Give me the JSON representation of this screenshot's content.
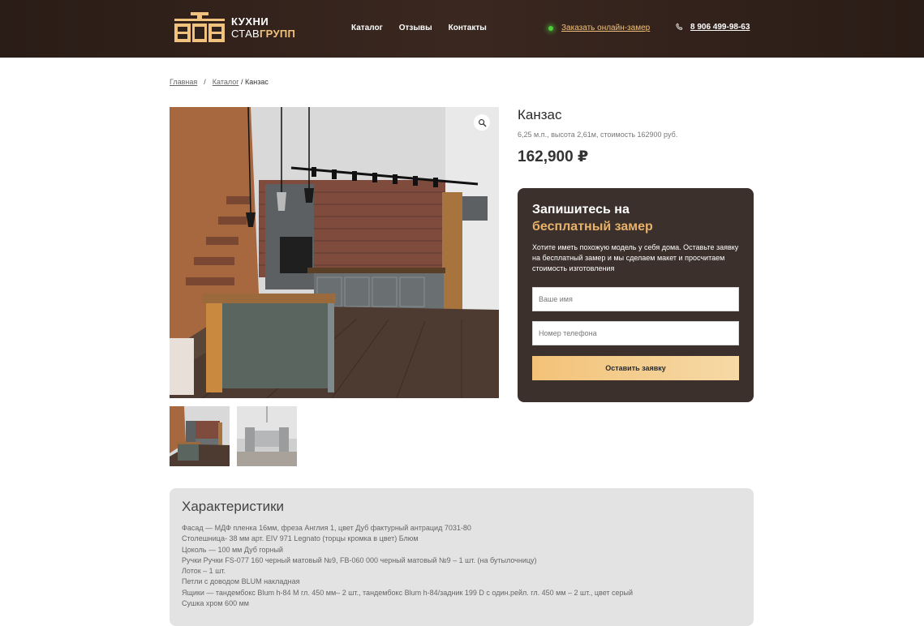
{
  "header": {
    "logo_line1": "КУХНИ",
    "logo_line2_a": "СТАВ",
    "logo_line2_b": "ГРУПП",
    "nav": [
      "Каталог",
      "Отзывы",
      "Контакты"
    ],
    "measure_link": "Заказать онлайн-замер",
    "phone": "8 906 499-98-63"
  },
  "breadcrumb": {
    "home": "Главная",
    "catalog": "Каталог",
    "current": "/ Канзас"
  },
  "product": {
    "title": "Канзас",
    "description": "6,25 м.п., высота 2,61м, стоимость 162900 руб.",
    "price": "162,900 ₽"
  },
  "form": {
    "heading_line1": "Запишитесь на",
    "heading_line2": "бесплатный замер",
    "text": "Хотите иметь похожую модель у себя дома. Оставьте заявку на бесплатный замер и мы сделаем макет и просчитаем стоимость изготовления",
    "name_placeholder": "Ваше имя",
    "phone_placeholder": "Номер телефона",
    "submit_label": "Оставить заявку"
  },
  "specs": {
    "title": "Характеристики",
    "lines": [
      "Фасад — МДФ пленка 16мм, фреза Англия 1, цвет Дуб фактурный антрацид 7031-80",
      "Столешница- 38 мм арт. EIV 971 Legnato (торцы кромка в цвет) Блюм",
      "Цоколь — 100 мм Дуб горный",
      "Ручки Ручки FS-077 160 черный матовый №9, FB-060 000 черный матовый №9 – 1 шт. (на бутылочницу)",
      "Лоток – 1 шт.",
      "Петли с доводом BLUM накладная",
      "Ящики — тандембокс Blum h-84 М гл. 450 мм– 2 шт., тандембокс Blum h-84/задник 199 D с один.рейл. гл. 450 мм – 2 шт., цвет серый",
      "Сушка хром 600 мм"
    ]
  },
  "colors": {
    "header_bg": "#2f211b",
    "accent": "#f0c27d",
    "card_bg": "#3b302c",
    "specs_bg": "#e3e3e3"
  }
}
